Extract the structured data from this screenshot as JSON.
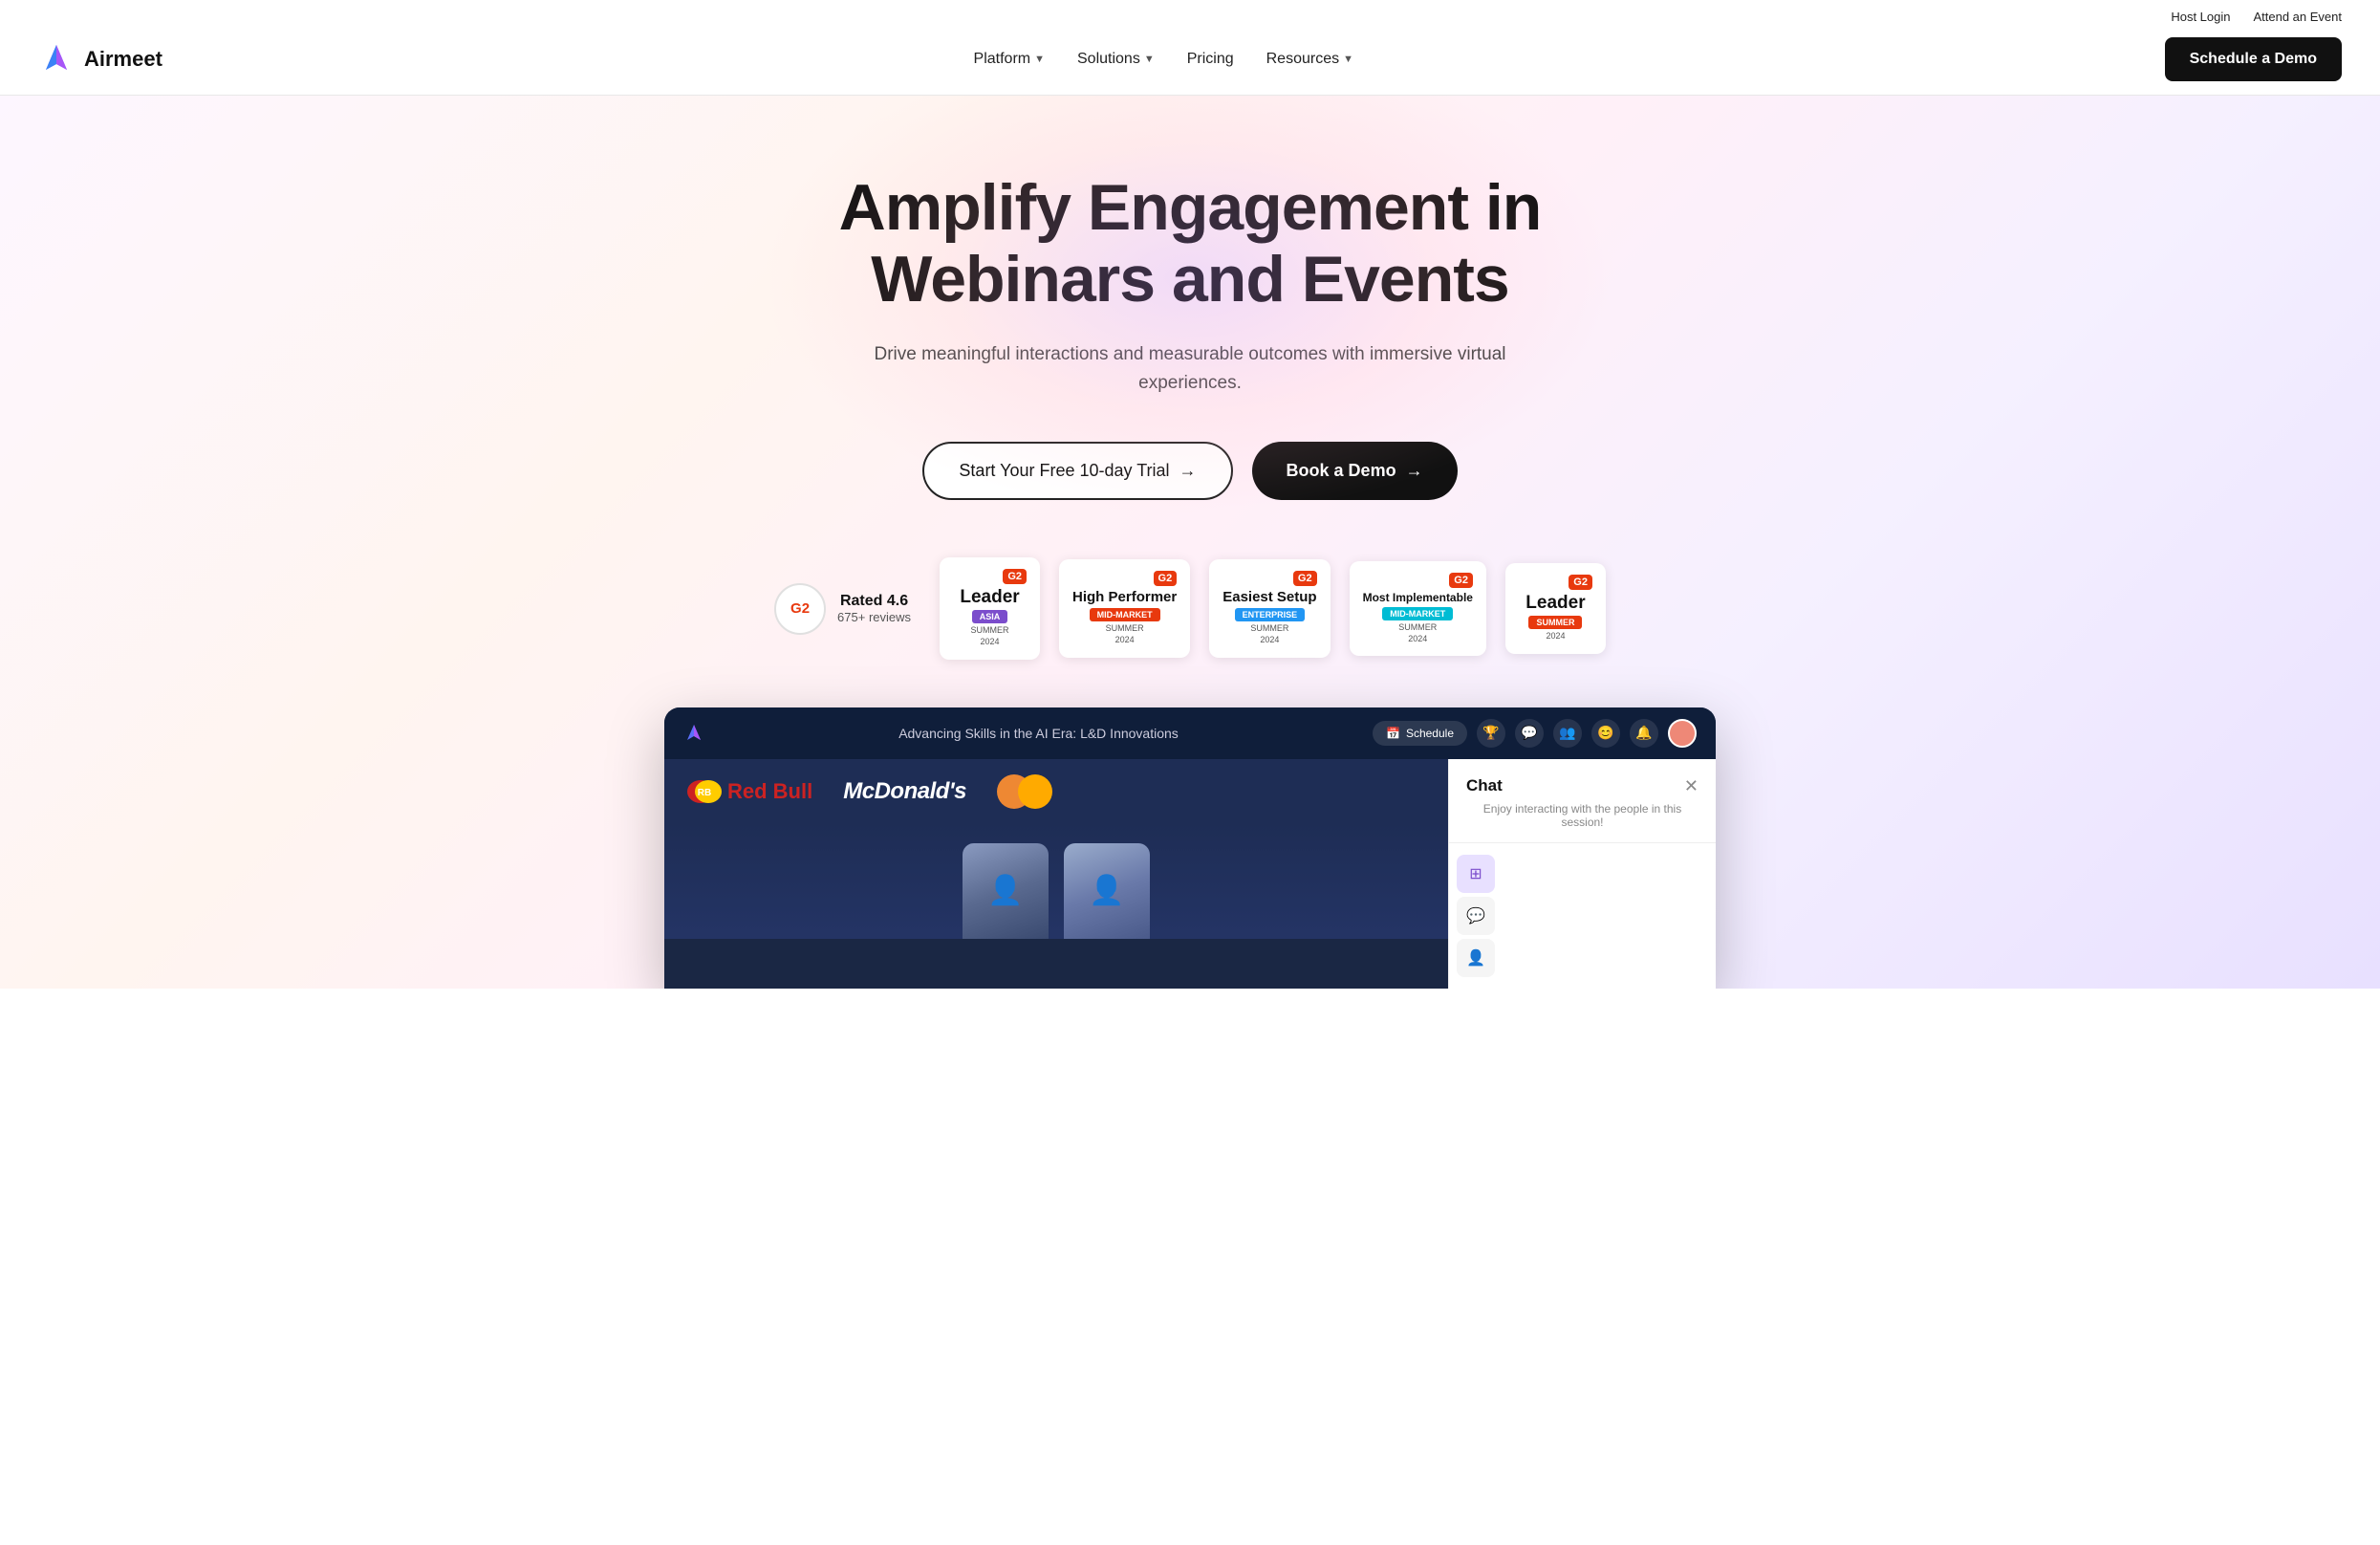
{
  "topbar": {
    "host_login": "Host Login",
    "attend_event": "Attend an Event"
  },
  "nav": {
    "logo_text": "Airmeet",
    "links": [
      {
        "label": "Platform",
        "has_dropdown": true
      },
      {
        "label": "Solutions",
        "has_dropdown": true
      },
      {
        "label": "Pricing",
        "has_dropdown": false
      },
      {
        "label": "Resources",
        "has_dropdown": true
      }
    ],
    "cta": "Schedule a Demo"
  },
  "hero": {
    "title": "Amplify Engagement in Webinars and Events",
    "subtitle": "Drive meaningful interactions and measurable outcomes with immersive virtual experiences.",
    "btn_trial": "Start Your Free 10-day Trial",
    "btn_demo": "Book a Demo",
    "arrow": "→"
  },
  "ratings": {
    "g2_label": "G2",
    "rated": "Rated 4.6",
    "reviews": "675+ reviews"
  },
  "badges": [
    {
      "title": "Leader",
      "sub": "Asia",
      "sub_color": "purple",
      "season": "SUMMER\n2024"
    },
    {
      "title": "High Performer",
      "sub": "Mid-Market",
      "sub_color": "orange",
      "season": "SUMMER\n2024"
    },
    {
      "title": "Easiest Setup",
      "sub": "Enterprise",
      "sub_color": "blue",
      "season": "SUMMER\n2024"
    },
    {
      "title": "Most Implementable",
      "sub": "Mid-Market",
      "sub_color": "teal",
      "season": "SUMMER\n2024"
    },
    {
      "title": "Leader",
      "sub": "SUMMER",
      "sub_color": "red",
      "season": "2024"
    }
  ],
  "preview": {
    "title": "Advancing Skills in the AI Era: L&D Innovations",
    "schedule_btn": "Schedule",
    "chat_title": "Chat",
    "chat_sub": "Enjoy interacting with the people in this session!",
    "sponsors": [
      "Red Bull",
      "McDonald's",
      "MasterCard"
    ],
    "close_icon": "✕"
  }
}
